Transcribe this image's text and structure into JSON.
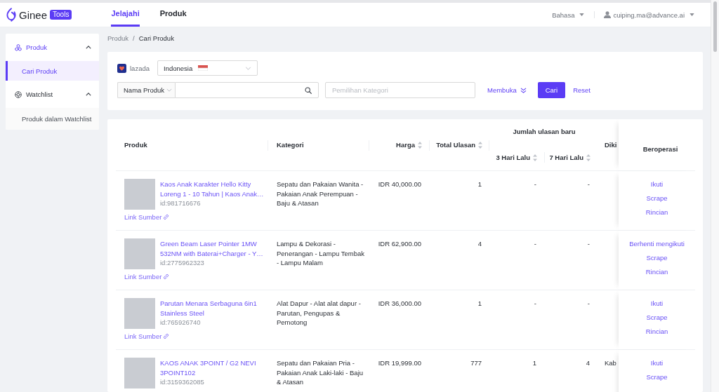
{
  "header": {
    "logo_text": "Ginee",
    "logo_badge": "Tools",
    "nav": [
      {
        "label": "Jelajahi",
        "selected": true
      },
      {
        "label": "Produk",
        "selected": false
      }
    ],
    "language": "Bahasa",
    "user": "cuiping.ma@advance.ai"
  },
  "sidebar": {
    "groups": [
      {
        "label": "Produk",
        "expanded": true,
        "children": [
          {
            "label": "Cari Produk",
            "selected": true
          }
        ]
      },
      {
        "label": "Watchlist",
        "expanded": true,
        "children": [
          {
            "label": "Produk dalam Watchlist",
            "selected": false
          }
        ]
      }
    ]
  },
  "breadcrumb": {
    "items": [
      "Produk",
      "Cari Produk"
    ],
    "separator": "/"
  },
  "filters": {
    "marketplace": "lazada",
    "country": "Indonesia",
    "search_type": "Nama Produk",
    "category": {
      "placeholder": "Pemilihan Kategori"
    },
    "expand_link": "Membuka",
    "search_button": "Cari",
    "reset_button": "Reset"
  },
  "table": {
    "columns": [
      {
        "label": "Produk",
        "sortable": false
      },
      {
        "label": "Kategori",
        "sortable": false
      },
      {
        "label": "Harga",
        "sortable": true
      },
      {
        "label": "Total Ulasan",
        "sortable": true
      },
      {
        "label": "Jumlah ulasan baru",
        "children": [
          {
            "label": "3 Hari Lalu",
            "sortable": true
          },
          {
            "label": "7 Hari Lalu",
            "sortable": true
          }
        ]
      },
      {
        "label": "Diki",
        "sortable": false
      },
      {
        "label": "Beroperasi",
        "sortable": false
      }
    ],
    "rows": [
      {
        "title": "Kaos Anak Karakter Hello Kitty Loreng 1 - 10 Tahun | Kaos Anak…",
        "id": "id:981716676",
        "link": "Link Sumber",
        "category": "Sepatu dan Pakaian Wanita - Pakaian Anak Perempuan - Baju & Atasan",
        "price": "IDR 40,000.00",
        "total_reviews": "1",
        "reviews_3_days": "-",
        "reviews_7_days": "-",
        "actions": [
          "Ikuti",
          "Scrape",
          "Rincian"
        ]
      },
      {
        "title": "Green Beam Laser Pointer 1MW 532NM with Baterai+Charger - Y…",
        "id": "id:2775962323",
        "link": "Link Sumber",
        "category": "Lampu & Dekorasi - Penerangan - Lampu Tembak - Lampu Malam",
        "price": "IDR 62,900.00",
        "total_reviews": "4",
        "reviews_3_days": "-",
        "reviews_7_days": "-",
        "actions": [
          "Berhenti mengikuti",
          "Scrape",
          "Rincian"
        ]
      },
      {
        "title": "Parutan Menara Serbaguna 6in1 Stainless Steel",
        "id": "id:765926740",
        "link": "Link Sumber",
        "category": "Alat Dapur - Alat alat dapur - Parutan, Pengupas & Pemotong",
        "price": "IDR 36,000.00",
        "total_reviews": "1",
        "reviews_3_days": "-",
        "reviews_7_days": "-",
        "actions": [
          "Ikuti",
          "Scrape",
          "Rincian"
        ]
      },
      {
        "title": "KAOS ANAK 3POINT / G2 NEVI 3POINT102",
        "id": "id:3159362085",
        "category": "Sepatu dan Pakaian Pria - Pakaian Anak Laki-laki - Baju & Atasan",
        "price": "IDR 19,999.00",
        "total_reviews": "777",
        "reviews_3_days": "1",
        "reviews_7_days": "4",
        "column_7": "Kab",
        "actions": [
          "Ikuti",
          "Scrape"
        ]
      }
    ]
  }
}
